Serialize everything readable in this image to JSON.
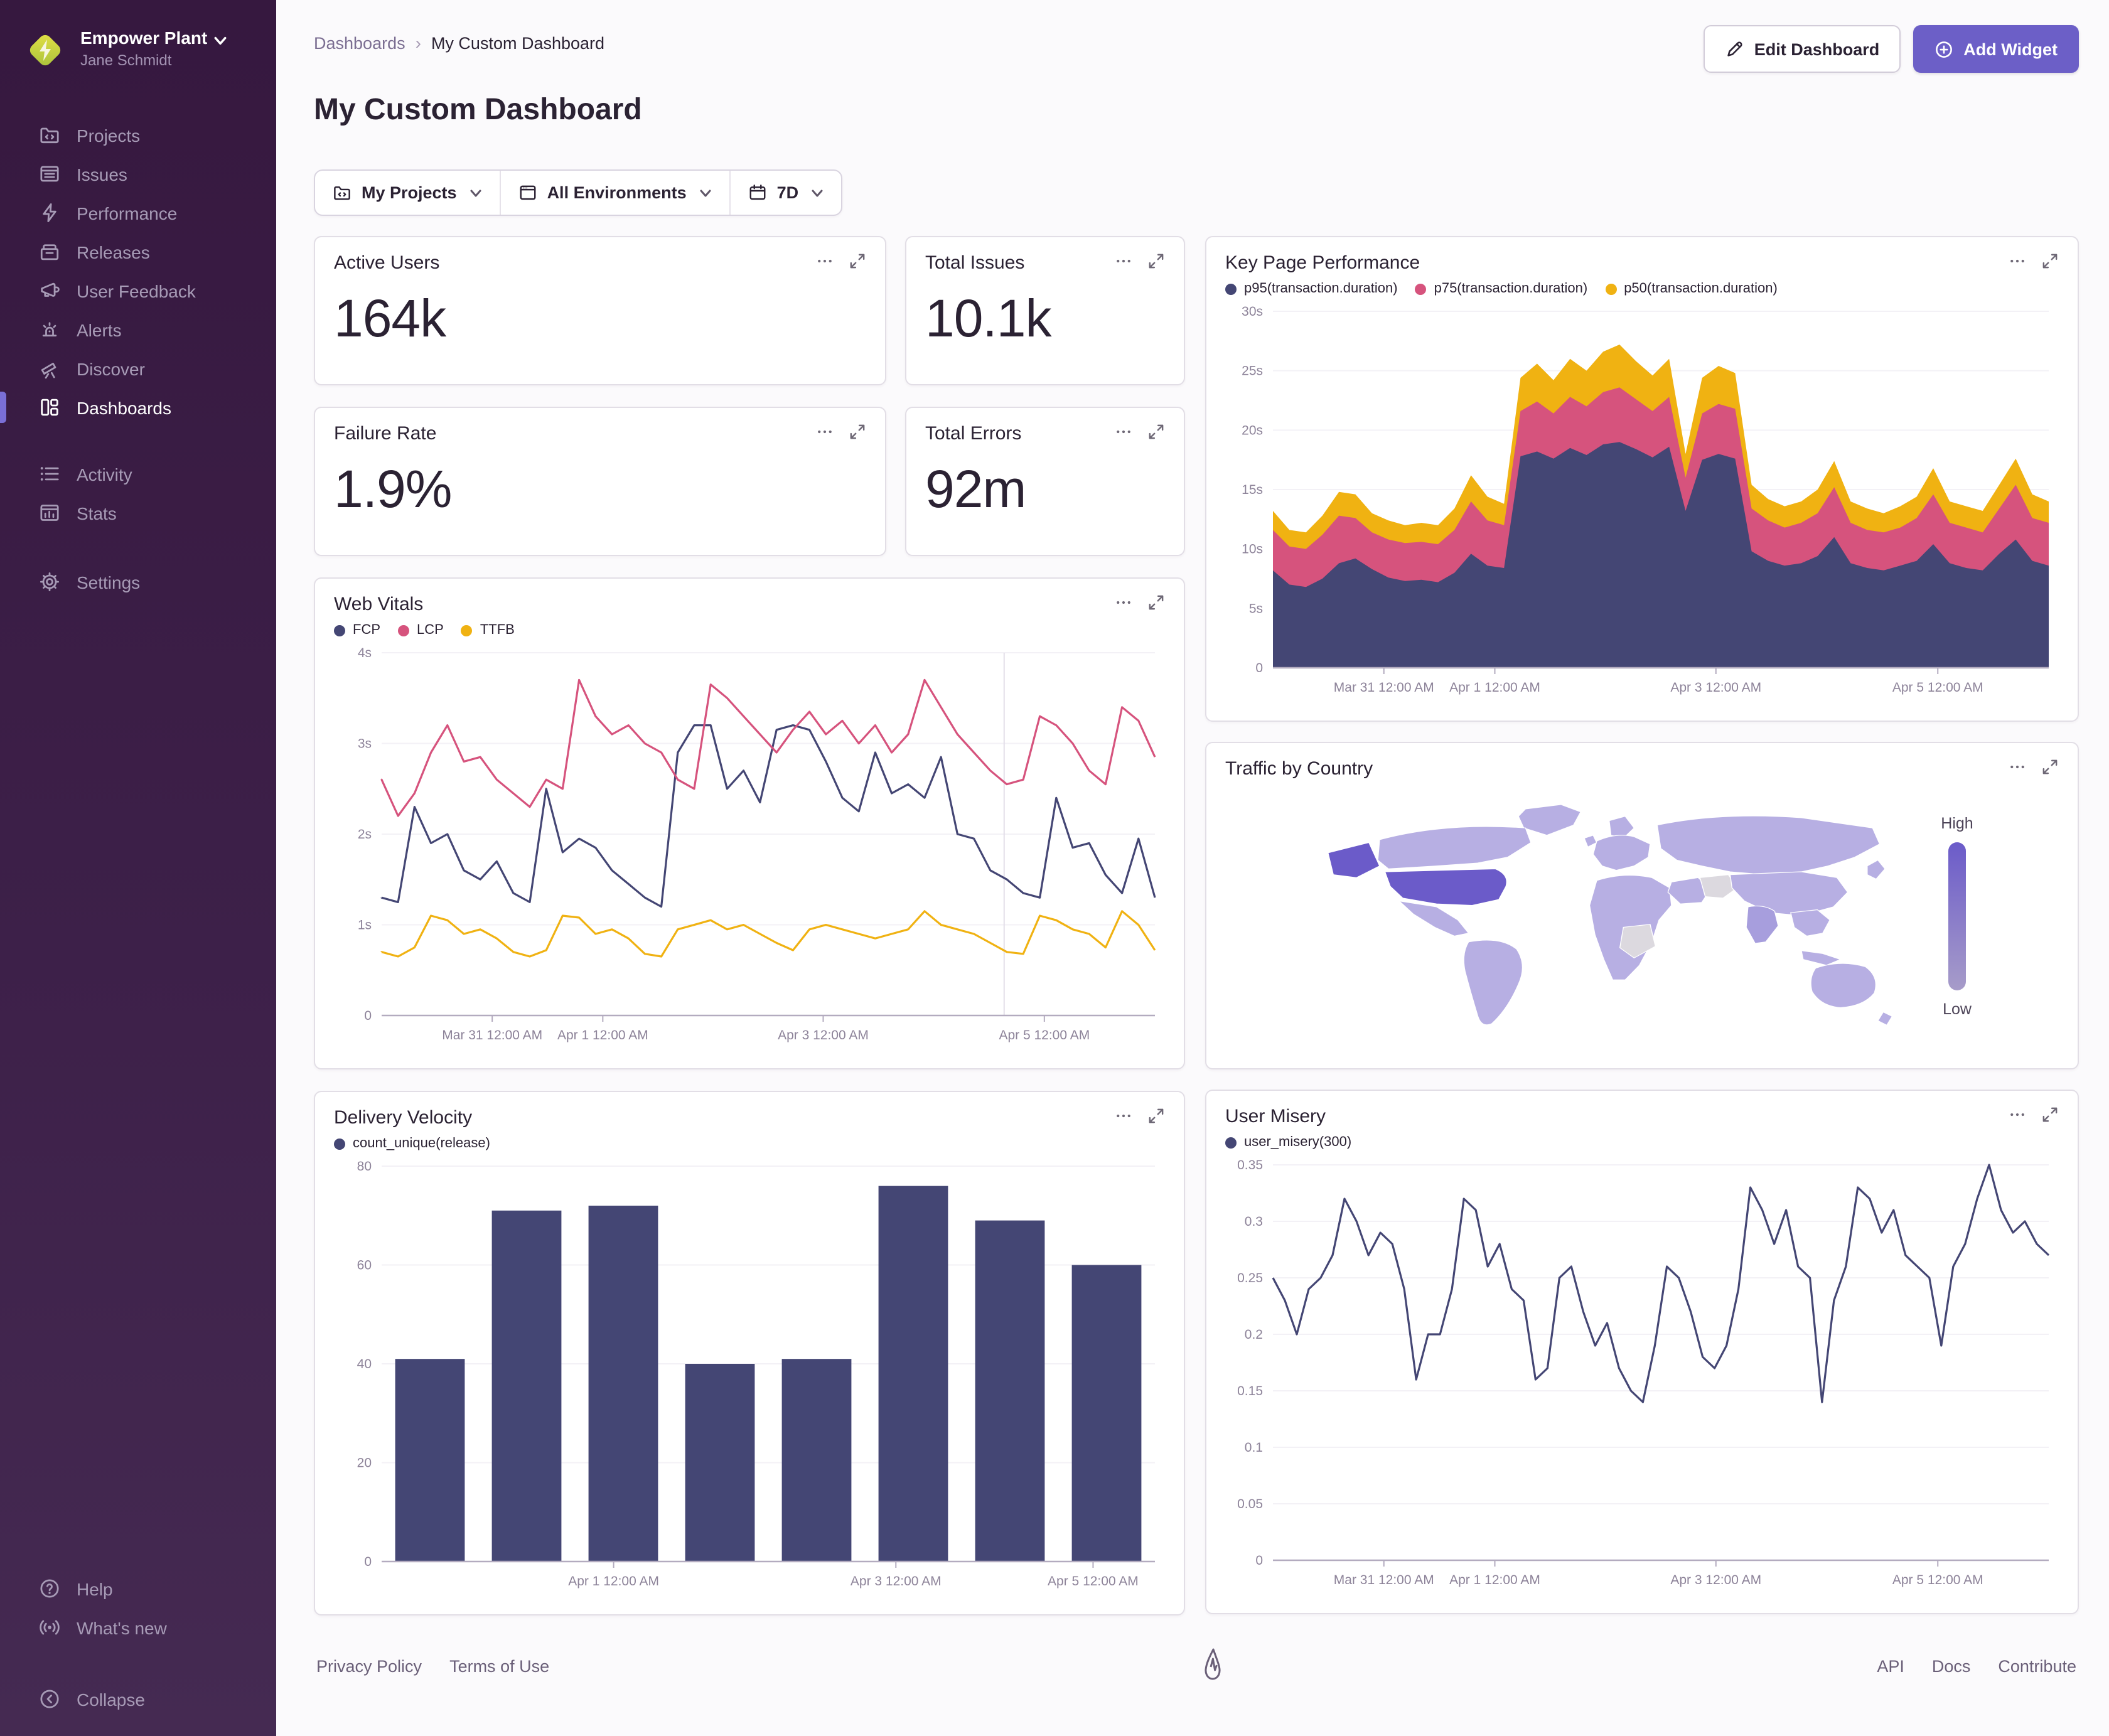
{
  "colors": {
    "accent": "#6c5fc7",
    "chart_navy": "#444674",
    "chart_pink": "#d6537d",
    "chart_yellow": "#f0b212",
    "axis": "#b3abbf",
    "tick_text": "#8d8399",
    "grid": "#f3f1f6",
    "map_base": "#b7afe3",
    "map_mid": "#a79edd",
    "map_high": "#6b5bc9",
    "map_nodata": "#dcd9df",
    "map_scale_low": "#a79cc9"
  },
  "sidebar": {
    "org": "Empower Plant",
    "user": "Jane Schmidt",
    "items": [
      {
        "label": "Projects",
        "icon": "projects-icon",
        "active": false,
        "group": 1
      },
      {
        "label": "Issues",
        "icon": "issues-icon",
        "active": false,
        "group": 1
      },
      {
        "label": "Performance",
        "icon": "performance-icon",
        "active": false,
        "group": 1
      },
      {
        "label": "Releases",
        "icon": "releases-icon",
        "active": false,
        "group": 1
      },
      {
        "label": "User Feedback",
        "icon": "feedback-icon",
        "active": false,
        "group": 1
      },
      {
        "label": "Alerts",
        "icon": "alerts-icon",
        "active": false,
        "group": 1
      },
      {
        "label": "Discover",
        "icon": "discover-icon",
        "active": false,
        "group": 1
      },
      {
        "label": "Dashboards",
        "icon": "dashboards-icon",
        "active": true,
        "group": 1
      },
      {
        "label": "Activity",
        "icon": "activity-icon",
        "active": false,
        "group": 2
      },
      {
        "label": "Stats",
        "icon": "stats-icon",
        "active": false,
        "group": 2
      },
      {
        "label": "Settings",
        "icon": "settings-icon",
        "active": false,
        "group": 3
      }
    ],
    "footer_items": [
      {
        "label": "Help",
        "icon": "help-icon"
      },
      {
        "label": "What's new",
        "icon": "whats-new-icon"
      },
      {
        "label": "Collapse",
        "icon": "collapse-icon"
      }
    ]
  },
  "header": {
    "breadcrumb": [
      "Dashboards",
      "My Custom Dashboard"
    ],
    "title": "My Custom Dashboard",
    "edit_label": "Edit Dashboard",
    "add_label": "Add Widget"
  },
  "filters": [
    {
      "icon": "folder-code-icon",
      "label": "My Projects"
    },
    {
      "icon": "window-icon",
      "label": "All Environments"
    },
    {
      "icon": "calendar-icon",
      "label": "7D"
    }
  ],
  "widgets": {
    "active_users": {
      "title": "Active Users",
      "value": "164k"
    },
    "total_issues": {
      "title": "Total Issues",
      "value": "10.1k"
    },
    "failure_rate": {
      "title": "Failure Rate",
      "value": "1.9%"
    },
    "total_errors": {
      "title": "Total Errors",
      "value": "92m"
    },
    "traffic": {
      "title": "Traffic by Country",
      "scale_high": "High",
      "scale_low": "Low"
    }
  },
  "footer": {
    "left": [
      "Privacy Policy",
      "Terms of Use"
    ],
    "right": [
      "API",
      "Docs",
      "Contribute"
    ]
  },
  "chart_data": [
    {
      "id": "key-page-performance",
      "type": "area",
      "title": "Key Page Performance",
      "stacked": true,
      "note": "series values are cumulative stack tops in seconds",
      "ylim": [
        0,
        30
      ],
      "y_ticks": [
        {
          "v": 0,
          "label": "0"
        },
        {
          "v": 5,
          "label": "5s"
        },
        {
          "v": 10,
          "label": "10s"
        },
        {
          "v": 15,
          "label": "15s"
        },
        {
          "v": 20,
          "label": "20s"
        },
        {
          "v": 25,
          "label": "25s"
        },
        {
          "v": 30,
          "label": "30s"
        }
      ],
      "x_ticks": [
        {
          "pos": 0.143,
          "label": "Mar 31 12:00 AM"
        },
        {
          "pos": 0.286,
          "label": "Apr 1 12:00 AM"
        },
        {
          "pos": 0.571,
          "label": "Apr 3 12:00 AM"
        },
        {
          "pos": 0.857,
          "label": "Apr 5 12:00 AM"
        }
      ],
      "series": [
        {
          "name": "p95(transaction.duration)",
          "color": "#444674",
          "values": [
            8.2,
            7.0,
            6.8,
            7.5,
            8.8,
            9.2,
            8.3,
            7.6,
            7.3,
            7.4,
            7.2,
            8.0,
            9.6,
            8.6,
            8.4,
            17.8,
            18.2,
            17.6,
            18.5,
            17.9,
            18.8,
            19.0,
            18.4,
            17.7,
            18.6,
            13.2,
            17.5,
            18.0,
            17.6,
            9.8,
            9.0,
            8.6,
            8.8,
            9.4,
            11.0,
            8.8,
            8.4,
            8.2,
            8.6,
            9.0,
            10.4,
            8.8,
            8.4,
            8.2,
            9.6,
            10.8,
            9.0,
            8.6
          ]
        },
        {
          "name": "p75(transaction.duration)",
          "color": "#d6537d",
          "values": [
            11.6,
            10.2,
            10.0,
            11.2,
            12.8,
            12.6,
            11.4,
            10.8,
            10.5,
            10.6,
            10.4,
            11.6,
            14.0,
            12.4,
            12.0,
            21.6,
            22.4,
            21.4,
            22.8,
            22.0,
            23.2,
            23.6,
            22.6,
            21.6,
            22.8,
            16.0,
            21.4,
            22.2,
            21.8,
            13.4,
            12.4,
            11.8,
            12.2,
            13.0,
            15.2,
            12.2,
            11.6,
            11.4,
            11.8,
            12.6,
            14.6,
            12.2,
            11.8,
            11.4,
            13.4,
            15.4,
            12.6,
            12.2
          ]
        },
        {
          "name": "p50(transaction.duration)",
          "color": "#f0b212",
          "values": [
            13.2,
            11.6,
            11.4,
            12.8,
            14.8,
            14.6,
            13.0,
            12.4,
            12.0,
            12.2,
            12.0,
            13.4,
            16.2,
            14.4,
            13.8,
            24.4,
            25.6,
            24.2,
            26.0,
            25.0,
            26.6,
            27.2,
            25.8,
            24.6,
            26.0,
            18.0,
            24.4,
            25.4,
            24.8,
            15.4,
            14.2,
            13.6,
            14.0,
            15.0,
            17.4,
            14.0,
            13.4,
            13.0,
            13.6,
            14.4,
            16.8,
            14.0,
            13.6,
            13.2,
            15.4,
            17.6,
            14.6,
            14.0
          ]
        }
      ]
    },
    {
      "id": "web-vitals",
      "type": "line",
      "title": "Web Vitals",
      "ylim": [
        0,
        4
      ],
      "marker_pos": 0.805,
      "y_ticks": [
        {
          "v": 0,
          "label": "0"
        },
        {
          "v": 1,
          "label": "1s"
        },
        {
          "v": 2,
          "label": "2s"
        },
        {
          "v": 3,
          "label": "3s"
        },
        {
          "v": 4,
          "label": "4s"
        }
      ],
      "x_ticks": [
        {
          "pos": 0.143,
          "label": "Mar 31 12:00 AM"
        },
        {
          "pos": 0.286,
          "label": "Apr 1 12:00 AM"
        },
        {
          "pos": 0.571,
          "label": "Apr 3 12:00 AM"
        },
        {
          "pos": 0.857,
          "label": "Apr 5 12:00 AM"
        }
      ],
      "series": [
        {
          "name": "FCP",
          "color": "#444674",
          "values": [
            1.3,
            1.25,
            2.3,
            1.9,
            2.0,
            1.6,
            1.5,
            1.7,
            1.35,
            1.25,
            2.5,
            1.8,
            1.95,
            1.85,
            1.6,
            1.45,
            1.3,
            1.2,
            2.9,
            3.2,
            3.2,
            2.5,
            2.7,
            2.35,
            3.15,
            3.2,
            3.15,
            2.8,
            2.4,
            2.25,
            2.9,
            2.45,
            2.55,
            2.4,
            2.85,
            2.0,
            1.95,
            1.6,
            1.5,
            1.35,
            1.3,
            2.4,
            1.85,
            1.9,
            1.55,
            1.35,
            1.95,
            1.3
          ]
        },
        {
          "name": "LCP",
          "color": "#d6537d",
          "values": [
            2.6,
            2.2,
            2.45,
            2.9,
            3.2,
            2.8,
            2.85,
            2.6,
            2.45,
            2.3,
            2.6,
            2.5,
            3.7,
            3.3,
            3.1,
            3.2,
            3.0,
            2.9,
            2.6,
            2.5,
            3.65,
            3.5,
            3.3,
            3.1,
            2.9,
            3.15,
            3.35,
            3.1,
            3.25,
            3.0,
            3.2,
            2.9,
            3.1,
            3.7,
            3.4,
            3.1,
            2.9,
            2.7,
            2.55,
            2.6,
            3.3,
            3.2,
            3.0,
            2.7,
            2.55,
            3.4,
            3.25,
            2.85
          ]
        },
        {
          "name": "TTFB",
          "color": "#f0b212",
          "values": [
            0.7,
            0.65,
            0.75,
            1.1,
            1.05,
            0.9,
            0.95,
            0.85,
            0.7,
            0.65,
            0.72,
            1.1,
            1.08,
            0.9,
            0.95,
            0.85,
            0.68,
            0.65,
            0.95,
            1.0,
            1.05,
            0.95,
            1.0,
            0.9,
            0.8,
            0.72,
            0.95,
            1.0,
            0.95,
            0.9,
            0.85,
            0.9,
            0.95,
            1.15,
            1.0,
            0.95,
            0.9,
            0.8,
            0.7,
            0.68,
            1.1,
            1.05,
            0.95,
            0.9,
            0.75,
            1.15,
            1.0,
            0.72
          ]
        }
      ]
    },
    {
      "id": "delivery-velocity",
      "type": "bar",
      "title": "Delivery Velocity",
      "bar_color": "#444674",
      "ylim": [
        0,
        80
      ],
      "y_ticks": [
        {
          "v": 0,
          "label": "0"
        },
        {
          "v": 20,
          "label": "20"
        },
        {
          "v": 40,
          "label": "40"
        },
        {
          "v": 60,
          "label": "60"
        },
        {
          "v": 80,
          "label": "80"
        }
      ],
      "x_ticks": [
        {
          "pos": 0.3,
          "label": "Apr 1 12:00 AM"
        },
        {
          "pos": 0.665,
          "label": "Apr 3 12:00 AM"
        },
        {
          "pos": 0.92,
          "label": "Apr 5 12:00 AM"
        }
      ],
      "series": [
        {
          "name": "count_unique(release)",
          "color": "#444674",
          "values": [
            41,
            71,
            72,
            40,
            41,
            76,
            69,
            60
          ]
        }
      ]
    },
    {
      "id": "user-misery",
      "type": "line",
      "title": "User Misery",
      "ylim": [
        0,
        0.35
      ],
      "y_ticks": [
        {
          "v": 0,
          "label": "0"
        },
        {
          "v": 0.05,
          "label": "0.05"
        },
        {
          "v": 0.1,
          "label": "0.1"
        },
        {
          "v": 0.15,
          "label": "0.15"
        },
        {
          "v": 0.2,
          "label": "0.2"
        },
        {
          "v": 0.25,
          "label": "0.25"
        },
        {
          "v": 0.3,
          "label": "0.3"
        },
        {
          "v": 0.35,
          "label": "0.35"
        }
      ],
      "x_ticks": [
        {
          "pos": 0.143,
          "label": "Mar 31 12:00 AM"
        },
        {
          "pos": 0.286,
          "label": "Apr 1 12:00 AM"
        },
        {
          "pos": 0.571,
          "label": "Apr 3 12:00 AM"
        },
        {
          "pos": 0.857,
          "label": "Apr 5 12:00 AM"
        }
      ],
      "series": [
        {
          "name": "user_misery(300)",
          "color": "#444674",
          "values": [
            0.25,
            0.23,
            0.2,
            0.24,
            0.25,
            0.27,
            0.32,
            0.3,
            0.27,
            0.29,
            0.28,
            0.24,
            0.16,
            0.2,
            0.2,
            0.24,
            0.32,
            0.31,
            0.26,
            0.28,
            0.24,
            0.23,
            0.16,
            0.17,
            0.25,
            0.26,
            0.22,
            0.19,
            0.21,
            0.17,
            0.15,
            0.14,
            0.19,
            0.26,
            0.25,
            0.22,
            0.18,
            0.17,
            0.19,
            0.24,
            0.33,
            0.31,
            0.28,
            0.31,
            0.26,
            0.25,
            0.14,
            0.23,
            0.26,
            0.33,
            0.32,
            0.29,
            0.31,
            0.27,
            0.26,
            0.25,
            0.19,
            0.26,
            0.28,
            0.32,
            0.35,
            0.31,
            0.29,
            0.3,
            0.28,
            0.27
          ]
        }
      ]
    }
  ]
}
